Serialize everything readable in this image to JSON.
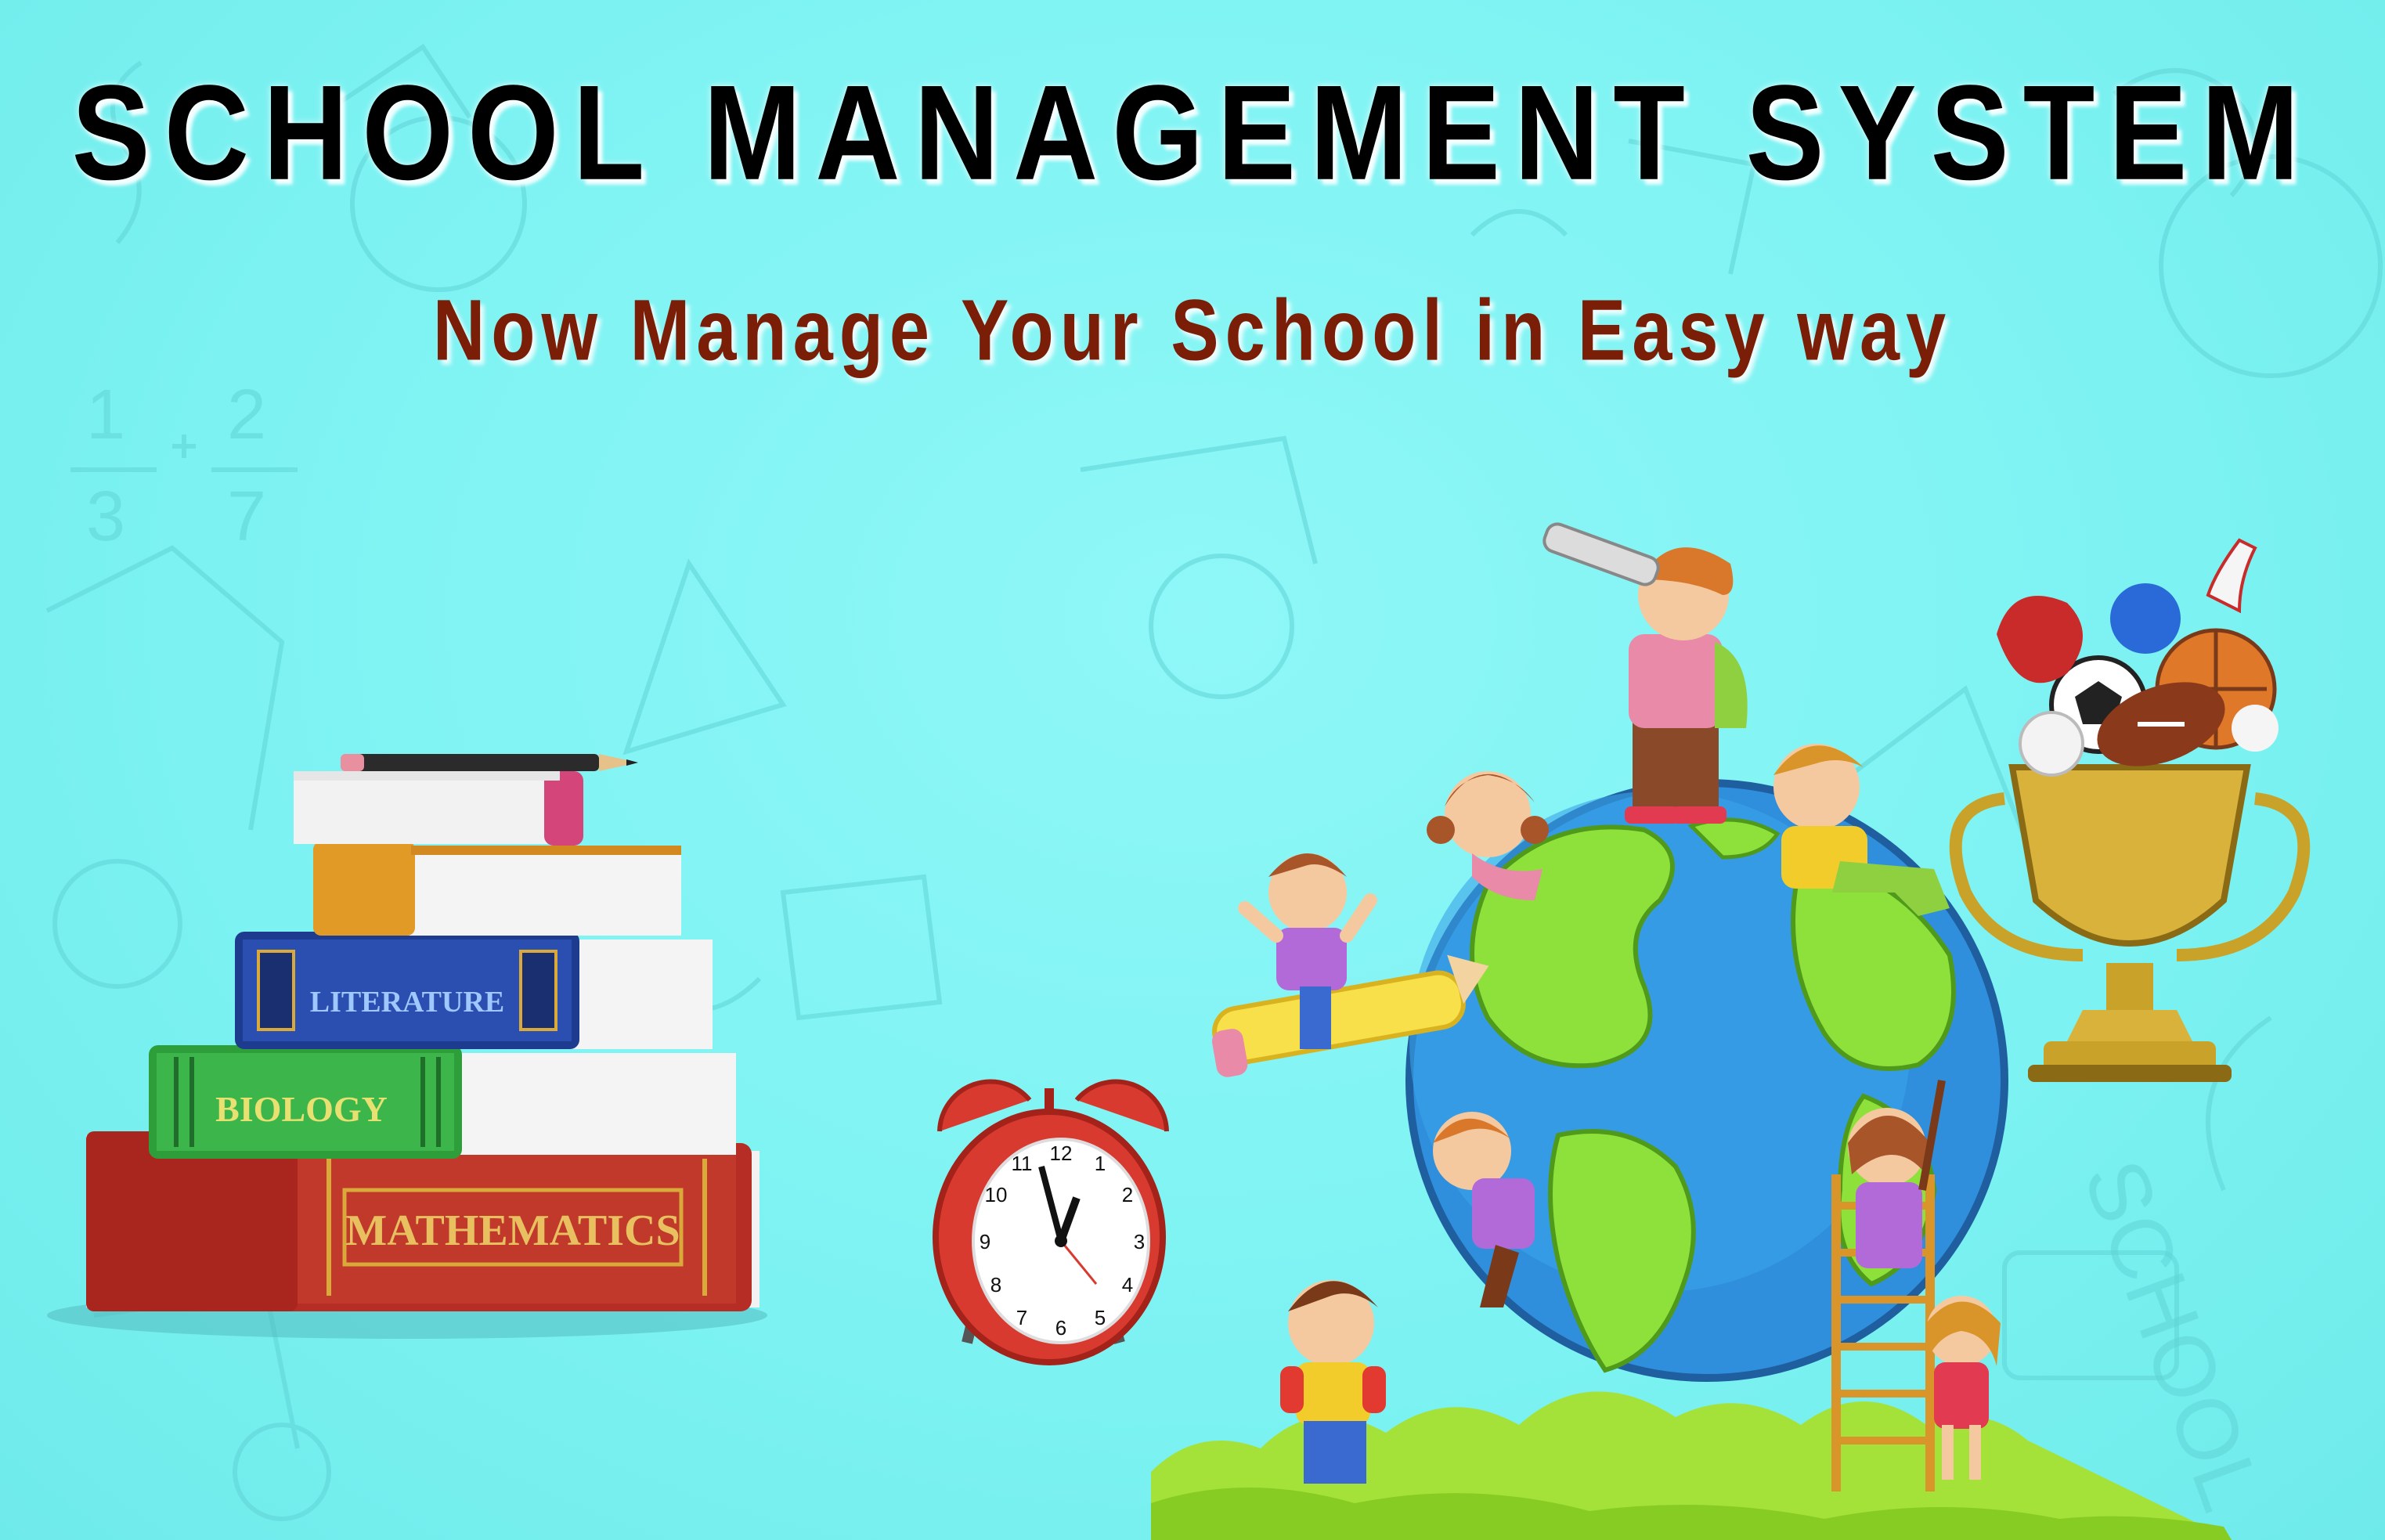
{
  "header": {
    "title": "SCHOOL MANAGEMENT SYSTEM",
    "subtitle": "Now Manage Your School in Easy way"
  },
  "books": {
    "literature": "LITERATURE",
    "biology": "BIOLOGY",
    "mathematics": "MATHEMATICS"
  },
  "clock": {
    "numbers": [
      "12",
      "1",
      "2",
      "3",
      "4",
      "5",
      "6",
      "7",
      "8",
      "9",
      "10",
      "11"
    ]
  },
  "doodles": {
    "fraction_a": "1",
    "fraction_b": "3",
    "fraction_c": "2",
    "fraction_d": "7",
    "school_word": "SCHOOL"
  },
  "colors": {
    "background": "#7ef4f4",
    "title": "#000000",
    "subtitle": "#7a1e08"
  }
}
